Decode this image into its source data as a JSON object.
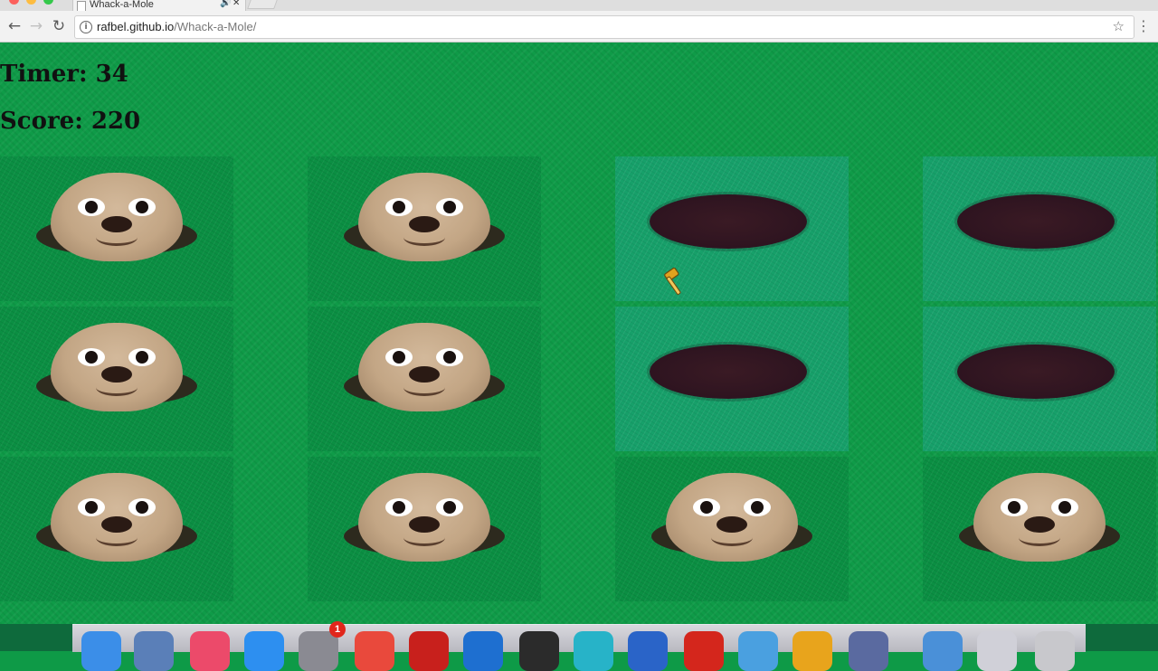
{
  "browser": {
    "tab_title": "Whack-a-Mole",
    "url_host": "rafbel.github.io",
    "url_path": "/Whack-a-Mole/"
  },
  "game": {
    "timer_text": "Timer: 34",
    "score_text": "Score: 220",
    "grid": [
      [
        "mole",
        "mole",
        "hole",
        "hole"
      ],
      [
        "mole",
        "mole",
        "hole",
        "hole"
      ],
      [
        "mole",
        "mole",
        "mole",
        "mole"
      ]
    ],
    "cursor": "hammer-cursor"
  },
  "dock": {
    "icons": [
      "finder",
      "preview",
      "itunes",
      "app-store",
      "system-preferences",
      "chrome",
      "adobe-acrobat",
      "remote-desktop",
      "terminal",
      "keep",
      "word",
      "filezilla",
      "xcode",
      "chrome-canary",
      "screen-recorder",
      "downloads",
      "documents",
      "trash"
    ],
    "notification_badge": "1"
  },
  "colors": {
    "page_bg": "#0f9b48",
    "cell_up_bg": "#0b8f43",
    "cell_down_bg": "#17a06a",
    "mole_body": "#c3a685",
    "hole": "#2e1420"
  }
}
